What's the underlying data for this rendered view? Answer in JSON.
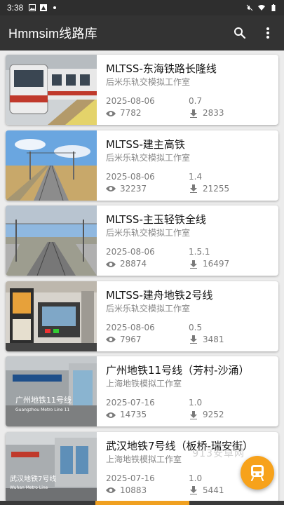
{
  "status_bar": {
    "time": "3:38"
  },
  "app_bar": {
    "title": "Hmmsim线路库",
    "search_icon": "search-icon",
    "menu_icon": "more-vert-icon"
  },
  "routes": [
    {
      "name": "MLTSS-东海铁路长隆线",
      "author": "后米乐轨交模拟工作室",
      "date": "2025-08-06",
      "version": "0.7",
      "views": "7782",
      "downloads": "2833",
      "thumb": "platform-train"
    },
    {
      "name": "MLTSS-建主高铁",
      "author": "后米乐轨交模拟工作室",
      "date": "2025-08-06",
      "version": "1.4",
      "views": "32237",
      "downloads": "21255",
      "thumb": "highspeed-track"
    },
    {
      "name": "MLTSS-主玉轻铁全线",
      "author": "后米乐轨交模拟工作室",
      "date": "2025-08-06",
      "version": "1.5.1",
      "views": "28874",
      "downloads": "16497",
      "thumb": "light-rail"
    },
    {
      "name": "MLTSS-建舟地铁2号线",
      "author": "后米乐轨交模拟工作室",
      "date": "2025-08-06",
      "version": "0.5",
      "views": "7967",
      "downloads": "3481",
      "thumb": "cab-interior"
    },
    {
      "name": "广州地铁11号线（芳村-沙涌）",
      "author": "上海地铁模拟工作室",
      "date": "2025-07-16",
      "version": "1.0",
      "views": "14735",
      "downloads": "9252",
      "thumb": "station-gz",
      "thumb_text_1": "广州地铁11号线",
      "thumb_text_2": "Guangzhou Metro Line 11"
    },
    {
      "name": "武汉地铁7号线（板桥-瑞安街）",
      "author": "上海地铁模拟工作室",
      "date": "2025-07-16",
      "version": "1.0",
      "views": "10883",
      "downloads": "5441",
      "thumb": "station-wh",
      "thumb_text_1": "武汉地铁7号线",
      "thumb_text_2": "Wuhan Metro Line"
    }
  ],
  "watermark": "913安卓网",
  "fab": {
    "icon": "train-icon"
  },
  "colors": {
    "app_bar": "#333333",
    "fab": "#f7a21b",
    "background": "#ececec"
  }
}
